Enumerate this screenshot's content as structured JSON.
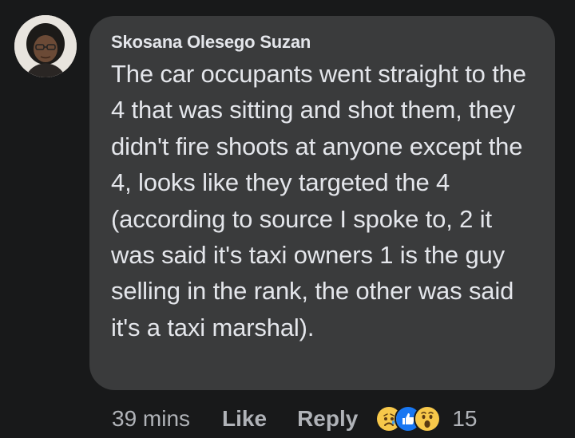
{
  "comment": {
    "author": "Skosana Olesego Suzan",
    "text": "The car occupants went straight to the 4 that was sitting and shot them, they didn't fire shoots at anyone except the 4, looks like they targeted the 4 (according to source I spoke to, 2 it was said it's taxi owners 1 is the guy selling in the rank, the other was said it's a taxi marshal)."
  },
  "actions": {
    "time": "39 mins",
    "like_label": "Like",
    "reply_label": "Reply",
    "reaction_icons": [
      "sad-reaction-icon",
      "like-reaction-icon",
      "wow-reaction-icon"
    ],
    "reaction_count": "15"
  },
  "colors": {
    "background": "#18191a",
    "bubble": "#3a3b3c",
    "text": "#e4e6eb",
    "secondary_text": "#b0b3b8",
    "like_blue": "#1877f2",
    "emoji_yellow": "#f7c84a"
  }
}
